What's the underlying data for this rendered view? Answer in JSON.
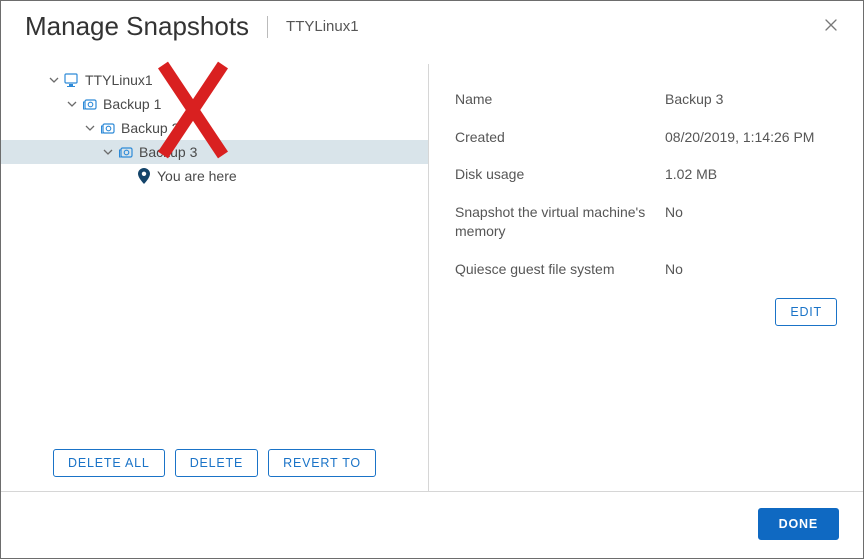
{
  "header": {
    "title": "Manage Snapshots",
    "vm": "TTYLinux1"
  },
  "tree": {
    "root": "TTYLinux1",
    "b1": "Backup 1",
    "b2": "Backup 2",
    "b3": "Backup 3",
    "here": "You are here"
  },
  "actions": {
    "delete_all": "Delete all",
    "delete": "Delete",
    "revert": "Revert to",
    "edit": "Edit",
    "done": "Done"
  },
  "details": {
    "name_label": "Name",
    "name_value": "Backup 3",
    "created_label": "Created",
    "created_value": "08/20/2019, 1:14:26 PM",
    "disk_label": "Disk usage",
    "disk_value": "1.02 MB",
    "mem_label": "Snapshot the virtual machine's memory",
    "mem_value": "No",
    "quiesce_label": "Quiesce guest file system",
    "quiesce_value": "No"
  }
}
